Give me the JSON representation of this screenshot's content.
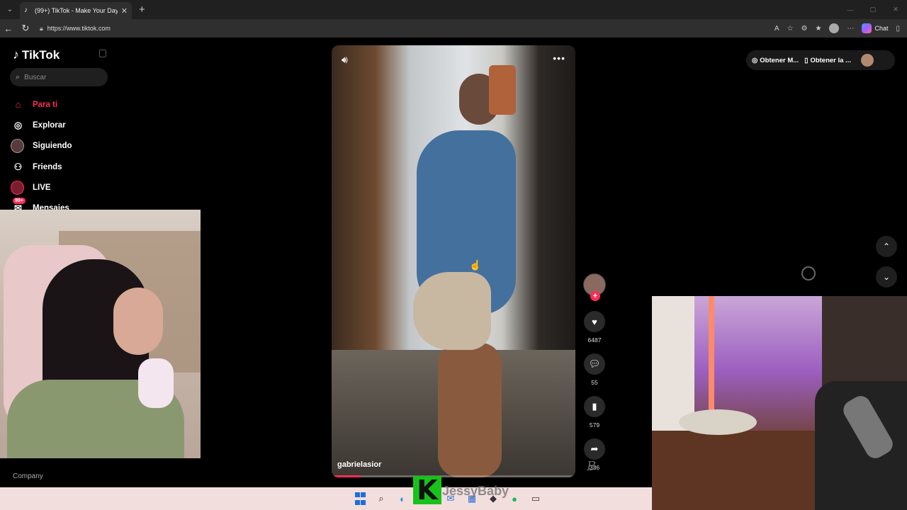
{
  "browser": {
    "tab_title": "(99+) TikTok - Make Your Day",
    "url": "https://www.tiktok.com",
    "chat_label": "Chat"
  },
  "tiktok": {
    "logo_text": "TikTok",
    "search_placeholder": "Buscar",
    "nav": [
      {
        "label": "Para ti"
      },
      {
        "label": "Explorar"
      },
      {
        "label": "Siguiendo"
      },
      {
        "label": "Friends"
      },
      {
        "label": "LIVE"
      },
      {
        "label": "Mensajes"
      }
    ],
    "messages_badge": "99+",
    "footer_company": "Company",
    "top_right": {
      "get_coins": "Obtener M...",
      "get_app": "Obtener la ..."
    },
    "video": {
      "author": "gabrielasior",
      "progress": 0.12,
      "likes": "6487",
      "comments": "55",
      "saves": "579",
      "shares": "336"
    }
  },
  "overlay": {
    "streamer_name": "JessyBaby",
    "k_logo": "K"
  },
  "colors": {
    "accent": "#fe2c55",
    "background": "#000000",
    "taskbar": "#f3dede"
  }
}
